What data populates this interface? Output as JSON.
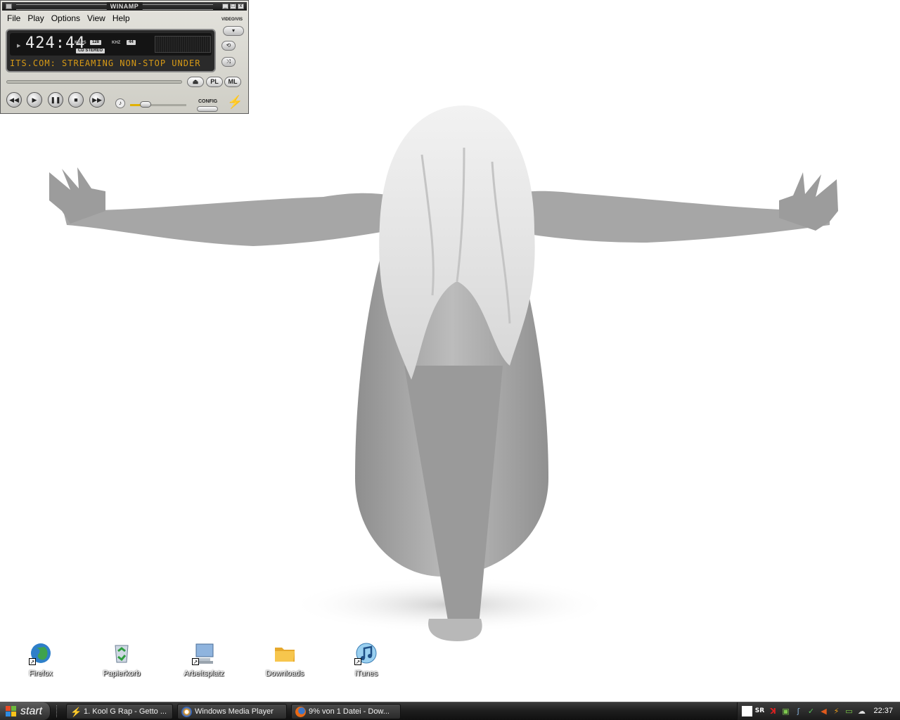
{
  "winamp": {
    "title": "WINAMP",
    "menu": [
      "File",
      "Play",
      "Options",
      "View",
      "Help"
    ],
    "time": "424:44",
    "kbps_label": "KBPS",
    "kbps_value": "128",
    "khz_label": "KHZ",
    "khz_value": "44",
    "stereo_label": "CD STEREO",
    "marquee": "ITS.COM: STREAMING NON-STOP UNDER",
    "video_vis_label": "VIDEO/VIS",
    "eject_label": "⏏",
    "pl_label": "PL",
    "ml_label": "ML",
    "config_label": "CONFIG",
    "transport": [
      "◀◀",
      "▶",
      "❚❚",
      "■",
      "▶▶"
    ],
    "volume_level": 0.28,
    "window_buttons": [
      "_",
      "□",
      "x"
    ]
  },
  "desktop": {
    "icons": [
      {
        "label": "Firefox",
        "icon": "firefox-globe-icon"
      },
      {
        "label": "Papierkorb",
        "icon": "recycle-bin-icon"
      },
      {
        "label": "Arbeitsplatz",
        "icon": "my-computer-icon"
      },
      {
        "label": "Downloads",
        "icon": "folder-icon"
      },
      {
        "label": "iTunes",
        "icon": "itunes-icon"
      }
    ]
  },
  "taskbar": {
    "start_label": "start",
    "tasks": [
      {
        "label": "1. Kool G Rap - Getto ...",
        "icon": "winamp-bolt-icon"
      },
      {
        "label": "Windows Media Player",
        "icon": "media-player-icon"
      },
      {
        "label": "9% von 1 Datei - Dow...",
        "icon": "firefox-icon"
      }
    ],
    "tray_text": "SR",
    "clock": "22:37"
  },
  "colors": {
    "winamp_marquee": "#d79a16",
    "taskbar_dark": "#1f1f1f",
    "start_button": "#3a3a3a"
  }
}
